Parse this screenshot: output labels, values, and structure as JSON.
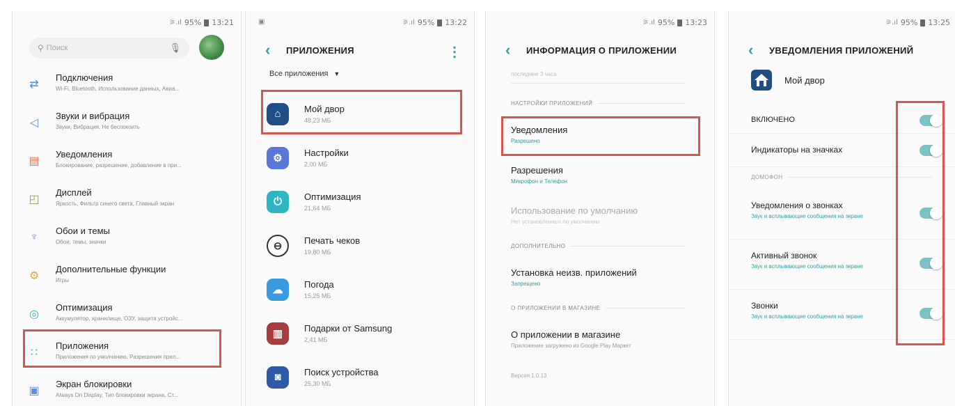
{
  "screen1": {
    "status": {
      "signal": "⚞.ıl",
      "battery": "95%",
      "time": "13:21"
    },
    "search_placeholder": "Поиск",
    "items": [
      {
        "icon": "connections-icon",
        "glyph": "⇄",
        "color": "#4a8fd6",
        "title": "Подключения",
        "subtitle": "Wi-Fi, Bluetooth, Использование данных, Авиа..."
      },
      {
        "icon": "sound-icon",
        "glyph": "◁",
        "color": "#5b8fd9",
        "title": "Звуки и вибрация",
        "subtitle": "Звуки, Вибрация, Не беспокоить"
      },
      {
        "icon": "notifications-icon",
        "glyph": "▤",
        "color": "#e0735a",
        "title": "Уведомления",
        "subtitle": "Блокирование, разрешение, добавление в при..."
      },
      {
        "icon": "display-icon",
        "glyph": "◰",
        "color": "#7aa84a",
        "title": "Дисплей",
        "subtitle": "Яркость, Фильтр синего света, Главный экран"
      },
      {
        "icon": "themes-icon",
        "glyph": "♆",
        "color": "#b87cc9",
        "title": "Обои и темы",
        "subtitle": "Обои, темы, значки"
      },
      {
        "icon": "advanced-features-icon",
        "glyph": "⚙",
        "color": "#e8a83a",
        "title": "Дополнительные функции",
        "subtitle": "Игры"
      },
      {
        "icon": "optimization-icon",
        "glyph": "◎",
        "color": "#3fb0b5",
        "title": "Оптимизация",
        "subtitle": "Аккумулятор, хранилище, ОЗУ, защита устройс..."
      },
      {
        "icon": "apps-icon",
        "glyph": "∷",
        "color": "#4aa6c9",
        "title": "Приложения",
        "subtitle": "Приложения по умолчанию, Разрешения прил..."
      },
      {
        "icon": "lock-screen-icon",
        "glyph": "▣",
        "color": "#5b8fd9",
        "title": "Экран блокировки",
        "subtitle": "Always On Display, Тип блокировки экрана, Ст..."
      }
    ]
  },
  "screen2": {
    "status": {
      "signal": "⚞.ıl",
      "battery": "95%",
      "time": "13:22",
      "left": "▣"
    },
    "title": "ПРИЛОЖЕНИЯ",
    "filter": "Все приложения",
    "apps": [
      {
        "icon": "my-yard-icon",
        "glyph": "⌂",
        "color": "#1f4e86",
        "name": "Мой двор",
        "size": "48,23 МБ"
      },
      {
        "icon": "settings-app-icon",
        "glyph": "⚙",
        "color": "#5877d6",
        "name": "Настройки",
        "size": "2,00 МБ"
      },
      {
        "icon": "optimization-app-icon",
        "glyph": "⏻",
        "color": "#2fb7c1",
        "name": "Оптимизация",
        "size": "21,64 МБ"
      },
      {
        "icon": "receipt-print-icon",
        "glyph": "⊖",
        "color": "#ffffff",
        "name": "Печать чеков",
        "size": "19,80 МБ"
      },
      {
        "icon": "weather-icon",
        "glyph": "☁",
        "color": "#3a9ae0",
        "name": "Погода",
        "size": "15,25 МБ"
      },
      {
        "icon": "samsung-gifts-icon",
        "glyph": "▥",
        "color": "#a73d3d",
        "name": "Подарки от Samsung",
        "size": "2,41 МБ"
      },
      {
        "icon": "find-device-icon",
        "glyph": "◙",
        "color": "#2e5aa8",
        "name": "Поиск устройства",
        "size": "25,30 МБ"
      }
    ]
  },
  "screen3": {
    "status": {
      "signal": "⚞.ıl",
      "battery": "95%",
      "time": "13:23"
    },
    "title": "ИНФОРМАЦИЯ О ПРИЛОЖЕНИИ",
    "cut_text": "последние 3 часа",
    "section_app_settings": "НАСТРОЙКИ ПРИЛОЖЕНИЙ",
    "notifications": {
      "title": "Уведомления",
      "value": "Разрешено"
    },
    "permissions": {
      "title": "Разрешения",
      "value": "Микрофон и Телефон"
    },
    "default": {
      "title": "Использование по умолчанию",
      "value": "Нет установленных по умолчанию"
    },
    "section_additional": "ДОПОЛНИТЕЛЬНО",
    "unknown_apps": {
      "title": "Установка неизв. приложений",
      "value": "Запрещено"
    },
    "section_store": "О ПРИЛОЖЕНИИ В МАГАЗИНЕ",
    "store": {
      "title": "О приложении в магазине",
      "value": "Приложение загружено из Google Play Маркет"
    },
    "version": "Версия 1.0.13"
  },
  "screen4": {
    "status": {
      "signal": "⚞.ıl",
      "battery": "95%",
      "time": "13:25"
    },
    "title": "УВЕДОМЛЕНИЯ ПРИЛОЖЕНИЙ",
    "app_name": "Мой двор",
    "enabled": "ВКЛЮЧЕНО",
    "badges": "Индикаторы на значках",
    "section": "ДОМОФОН",
    "call_notifications": {
      "title": "Уведомления о звонках",
      "sub": "Звук и всплывающие сообщения на экране"
    },
    "active_call": {
      "title": "Активный звонок",
      "sub": "Звук и всплывающие сообщения на экране"
    },
    "calls": {
      "title": "Звонки",
      "sub": "Звук и всплывающие сообщения на экране"
    },
    "toggles_on": [
      true,
      true,
      true,
      true,
      true
    ]
  },
  "colors": {
    "accent": "#3a9b9b",
    "highlight": "#d9534f",
    "toggle": "#7dc3c6"
  }
}
